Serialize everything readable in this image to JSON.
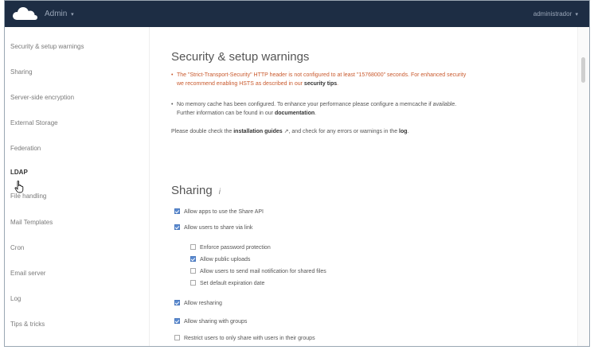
{
  "header": {
    "app_menu_label": "Admin",
    "user_menu_label": "administrador",
    "caret": "▾"
  },
  "sidebar": {
    "items": [
      {
        "label": "Security & setup warnings"
      },
      {
        "label": "Sharing"
      },
      {
        "label": "Server-side encryption"
      },
      {
        "label": "External Storage"
      },
      {
        "label": "Federation"
      },
      {
        "label": "LDAP"
      },
      {
        "label": "File handling"
      },
      {
        "label": "Mail Templates"
      },
      {
        "label": "Cron"
      },
      {
        "label": "Email server"
      },
      {
        "label": "Log"
      },
      {
        "label": "Tips & tricks"
      }
    ]
  },
  "security": {
    "title": "Security & setup warnings",
    "hsts_line1": "The \"Strict-Transport-Security\" HTTP header is not configured to at least \"15768000\" seconds. For enhanced security",
    "hsts_line2_prefix": "we recommend enabling HSTS as described in our ",
    "hsts_link": "security tips",
    "hsts_line2_suffix": ".",
    "memcache_line1": "No memory cache has been configured. To enhance your performance please configure a memcache if available.",
    "memcache_line2_prefix": "Further information can be found in our ",
    "memcache_link": "documentation",
    "memcache_line2_suffix": ".",
    "check_prefix": "Please double check the ",
    "check_link": "installation guides",
    "check_icon": "↗",
    "check_middle": ", and check for any errors or warnings in the ",
    "check_log_link": "log",
    "check_suffix": "."
  },
  "sharing": {
    "title": "Sharing",
    "info_icon": "i",
    "options": [
      {
        "label": "Allow apps to use the Share API",
        "checked": true
      },
      {
        "label": "Allow users to share via link",
        "checked": true
      },
      {
        "label": "Enforce password protection",
        "checked": false
      },
      {
        "label": "Allow public uploads",
        "checked": true
      },
      {
        "label": "Allow users to send mail notification for shared files",
        "checked": false
      },
      {
        "label": "Set default expiration date",
        "checked": false
      },
      {
        "label": "Allow resharing",
        "checked": true
      },
      {
        "label": "Allow sharing with groups",
        "checked": true
      },
      {
        "label": "Restrict users to only share with users in their groups",
        "checked": false
      }
    ]
  },
  "colors": {
    "header_bg": "#1d2d44",
    "warning_text": "#c95a2e",
    "checkbox_checked": "#5b8bd1"
  }
}
